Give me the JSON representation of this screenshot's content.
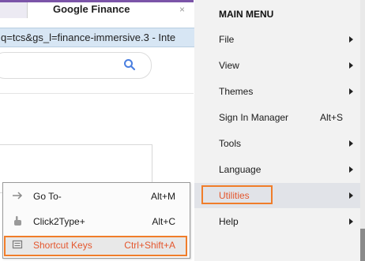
{
  "browser": {
    "tab_title": "Google Finance",
    "tab_close": "×",
    "address_text": "q=tcs&gs_l=finance-immersive.3 - Inte"
  },
  "main_menu": {
    "title": "MAIN MENU",
    "items": [
      {
        "label": "File",
        "shortcut": "",
        "submenu": true
      },
      {
        "label": "View",
        "shortcut": "",
        "submenu": true
      },
      {
        "label": "Themes",
        "shortcut": "",
        "submenu": true
      },
      {
        "label": "Sign In Manager",
        "shortcut": "Alt+S",
        "submenu": false
      },
      {
        "label": "Tools",
        "shortcut": "",
        "submenu": true
      },
      {
        "label": "Language",
        "shortcut": "",
        "submenu": true
      },
      {
        "label": "Utilities",
        "shortcut": "",
        "submenu": true,
        "active": true
      },
      {
        "label": "Help",
        "shortcut": "",
        "submenu": true
      }
    ]
  },
  "utilities_submenu": {
    "items": [
      {
        "label": "Go To-",
        "shortcut": "Alt+M",
        "icon": "arrow-right-icon"
      },
      {
        "label": "Click2Type+",
        "shortcut": "Alt+C",
        "icon": "hand-pointer-icon"
      },
      {
        "label": "Shortcut Keys",
        "shortcut": "Ctrl+Shift+A",
        "icon": "keyboard-icon",
        "active": true
      }
    ]
  },
  "colors": {
    "highlight_border": "#f07d2a",
    "active_text": "#e4572e",
    "menu_background": "#f2f2f2",
    "tab_accent": "#7b54a8"
  }
}
